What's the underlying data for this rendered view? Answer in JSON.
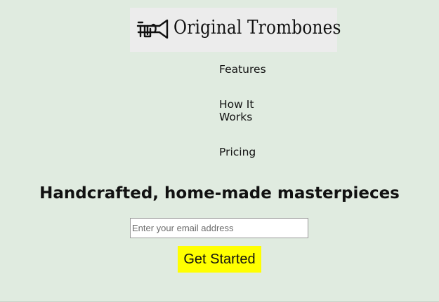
{
  "brand": {
    "name": "Original Trombones",
    "icon": "trombone-icon"
  },
  "nav": {
    "items": [
      {
        "label": "Features"
      },
      {
        "label": "How It Works"
      },
      {
        "label": "Pricing"
      }
    ]
  },
  "hero": {
    "headline": "Handcrafted, home-made masterpieces",
    "email_placeholder": "Enter your email address",
    "email_value": "",
    "cta_label": "Get Started"
  },
  "colors": {
    "background": "#e0ebe0",
    "logo_background": "#ececec",
    "cta_background": "#ffff00",
    "text": "#111111"
  }
}
